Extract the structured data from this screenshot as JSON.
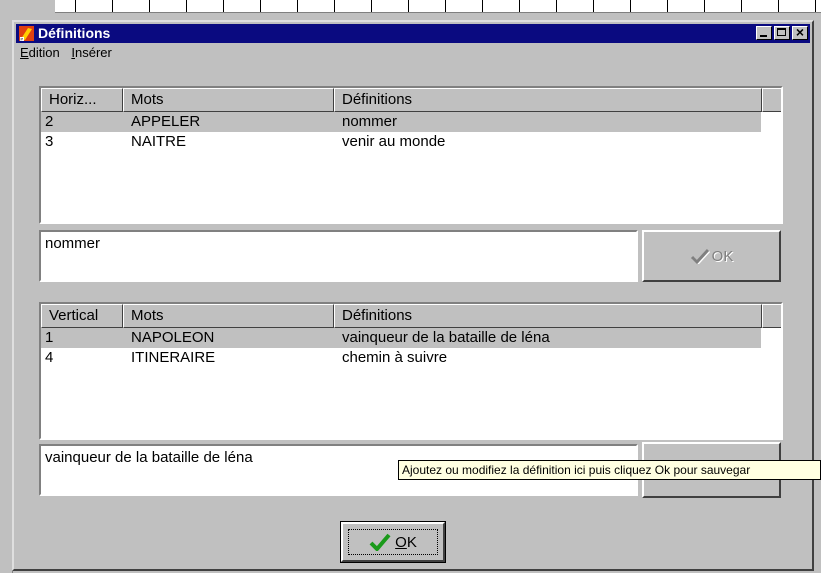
{
  "window": {
    "title": "Définitions",
    "menu": [
      {
        "accel": "E",
        "rest": "dition"
      },
      {
        "accel": "I",
        "rest": "nsérer"
      }
    ]
  },
  "horizontal": {
    "columns": [
      "Horiz...",
      "Mots",
      "Définitions"
    ],
    "rows": [
      {
        "num": "2",
        "mot": "APPELER",
        "def": "nommer",
        "selected": true
      },
      {
        "num": "3",
        "mot": "NAITRE",
        "def": "venir au monde",
        "selected": false
      }
    ],
    "edit_value": "nommer",
    "ok_label": "OK"
  },
  "vertical": {
    "columns": [
      "Vertical",
      "Mots",
      "Définitions"
    ],
    "rows": [
      {
        "num": "1",
        "mot": "NAPOLEON",
        "def": "vainqueur de la bataille de léna",
        "selected": true
      },
      {
        "num": "4",
        "mot": "ITINERAIRE",
        "def": "chemin à suivre",
        "selected": false
      }
    ],
    "edit_value": "vainqueur de la bataille de léna"
  },
  "tooltip": "Ajoutez ou modifiez la définition ici puis cliquez Ok pour sauvegar",
  "main_ok": {
    "accel": "O",
    "rest": "K"
  },
  "colors": {
    "titlebar": "#0a0a80",
    "face": "#c0c0c0",
    "tooltip": "#ffffe1",
    "check": "#1a9a1a"
  }
}
